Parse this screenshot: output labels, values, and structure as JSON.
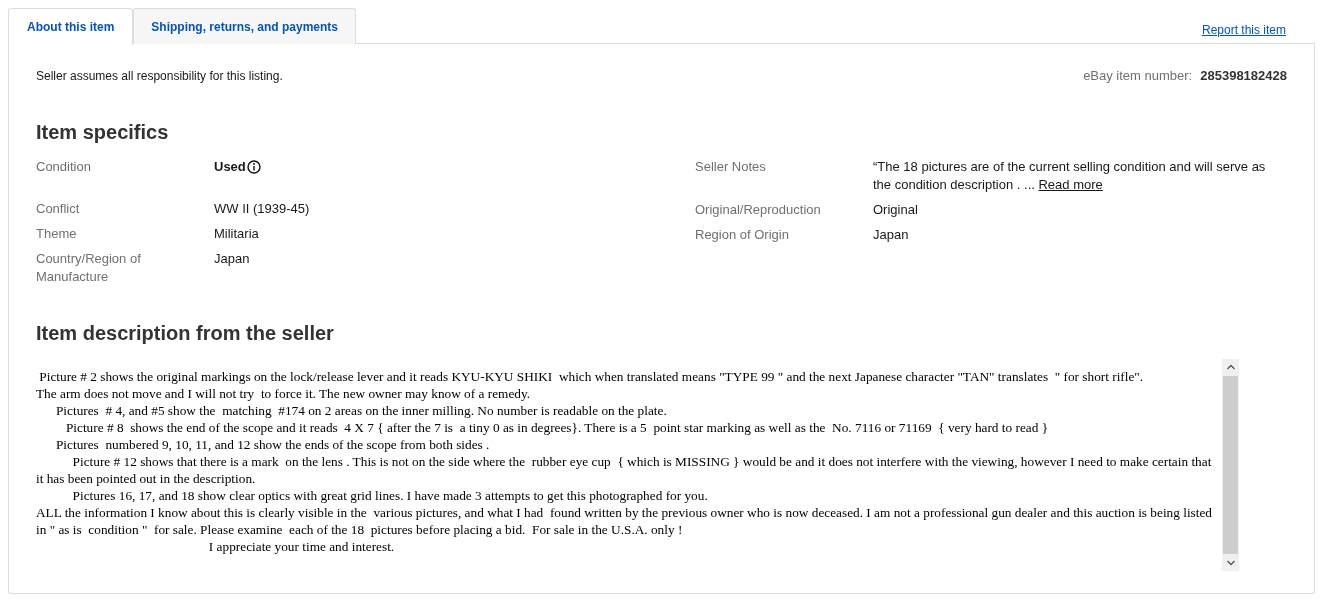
{
  "tabs": [
    {
      "label": "About this item",
      "selected": true
    },
    {
      "label": "Shipping, returns, and payments",
      "selected": false
    }
  ],
  "report_link": "Report this item",
  "responsibility": "Seller assumes all responsibility for this listing.",
  "item_number": {
    "label": "eBay item number:",
    "value": "285398182428"
  },
  "specifics": {
    "title": "Item specifics",
    "left": [
      {
        "kind": "condition",
        "label": "Condition",
        "value": "Used"
      },
      {
        "kind": "text",
        "label": "Conflict",
        "value": "WW II (1939-45)"
      },
      {
        "kind": "text",
        "label": "Theme",
        "value": "Militaria"
      },
      {
        "kind": "text",
        "label": "Country/Region of Manufacture",
        "value": "Japan"
      }
    ],
    "right": [
      {
        "kind": "notes",
        "label": "Seller Notes",
        "value": "“The 18 pictures are of the current selling condition and will serve as the condition description . ...",
        "link": "Read more"
      },
      {
        "kind": "text",
        "label": "Original/Reproduction",
        "value": "Original"
      },
      {
        "kind": "text",
        "label": "Region of Origin",
        "value": "Japan"
      }
    ]
  },
  "description": {
    "title": "Item description from the seller",
    "paragraphs": [
      " Picture # 2 shows the original markings on the lock/release lever and it reads KYU-KYU SHIKI  which when translated means \"TYPE 99 \" and the next Japanese character \"TAN\" translates  \" for short rifle\".",
      "The arm does not move and I will not try  to force it. The new owner may know of a remedy.",
      "      Pictures  # 4, and #5 show the  matching  #174 on 2 areas on the inner milling. No number is readable on the plate.",
      "         Picture # 8  shows the end of the scope and it reads  4 X 7 { after the 7 is  a tiny 0 as in degrees}. There is a 5  point star marking as well as the  No. 7116 or 71169  { very hard to read }",
      "      Pictures  numbered 9, 10, 11, and 12 show the ends of the scope from both sides .",
      "           Picture # 12 shows that there is a mark  on the lens . This is not on the side where the  rubber eye cup  { which is MISSING } would be and it does not interfere with the viewing, however I need to make certain that it has been pointed out in the description.",
      "           Pictures 16, 17, and 18 show clear optics with great grid lines. I have made 3 attempts to get this photographed for you.",
      "ALL the information I know about this is clearly visible in the  various pictures, and what I had  found written by the previous owner who is now deceased. I am not a professional gun dealer and this auction is being listed  in \" as is  condition \"  for sale. Please examine  each of the 18  pictures before placing a bid.  For sale in the U.S.A. only !",
      "                                                    I appreciate your time and interest."
    ]
  }
}
